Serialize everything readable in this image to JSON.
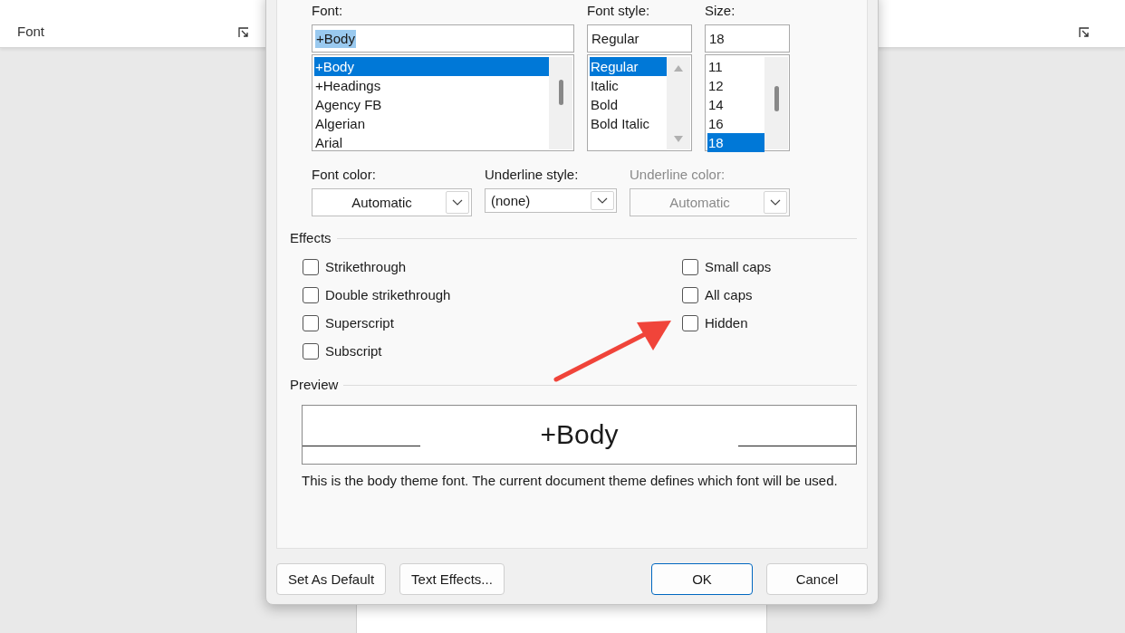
{
  "ribbon": {
    "group_label": "Font"
  },
  "dialog": {
    "font": {
      "label": "Font:",
      "value": "+Body",
      "value_highlighted": true,
      "options": [
        {
          "label": "+Body",
          "selected": true
        },
        {
          "label": "+Headings",
          "selected": false
        },
        {
          "label": "Agency FB",
          "selected": false
        },
        {
          "label": "Algerian",
          "selected": false
        },
        {
          "label": "Arial",
          "selected": false
        }
      ]
    },
    "font_style": {
      "label": "Font style:",
      "value": "Regular",
      "value_highlighted": false,
      "options": [
        {
          "label": "Regular",
          "selected": true
        },
        {
          "label": "Italic",
          "selected": false
        },
        {
          "label": "Bold",
          "selected": false
        },
        {
          "label": "Bold Italic",
          "selected": false
        }
      ]
    },
    "size": {
      "label": "Size:",
      "value": "18",
      "value_highlighted": false,
      "options": [
        {
          "label": "11",
          "selected": false
        },
        {
          "label": "12",
          "selected": false
        },
        {
          "label": "14",
          "selected": false
        },
        {
          "label": "16",
          "selected": false
        },
        {
          "label": "18",
          "selected": true
        }
      ]
    },
    "dropdowns": [
      {
        "label": "Font color:",
        "value": "Automatic",
        "disabled": false,
        "kind": "centered"
      },
      {
        "label": "Underline style:",
        "value": "(none)",
        "disabled": false,
        "kind": "left"
      },
      {
        "label": "Underline color:",
        "value": "Automatic",
        "disabled": true,
        "kind": "centered"
      }
    ],
    "effects": {
      "title": "Effects",
      "left": [
        {
          "label": "Strikethrough",
          "checked": false
        },
        {
          "label": "Double strikethrough",
          "checked": false
        },
        {
          "label": "Superscript",
          "checked": false
        },
        {
          "label": "Subscript",
          "checked": false
        }
      ],
      "right": [
        {
          "label": "Small caps",
          "checked": false
        },
        {
          "label": "All caps",
          "checked": false
        },
        {
          "label": "Hidden",
          "checked": false
        }
      ]
    },
    "preview": {
      "title": "Preview",
      "sample": "+Body",
      "description": "This is the body theme font. The current document theme defines which font will be used."
    },
    "buttons": [
      {
        "label": "Set As Default",
        "kind": "normal"
      },
      {
        "label": "Text Effects...",
        "kind": "normal"
      },
      {
        "label": "OK",
        "kind": "default"
      },
      {
        "label": "Cancel",
        "kind": "normal"
      }
    ]
  }
}
